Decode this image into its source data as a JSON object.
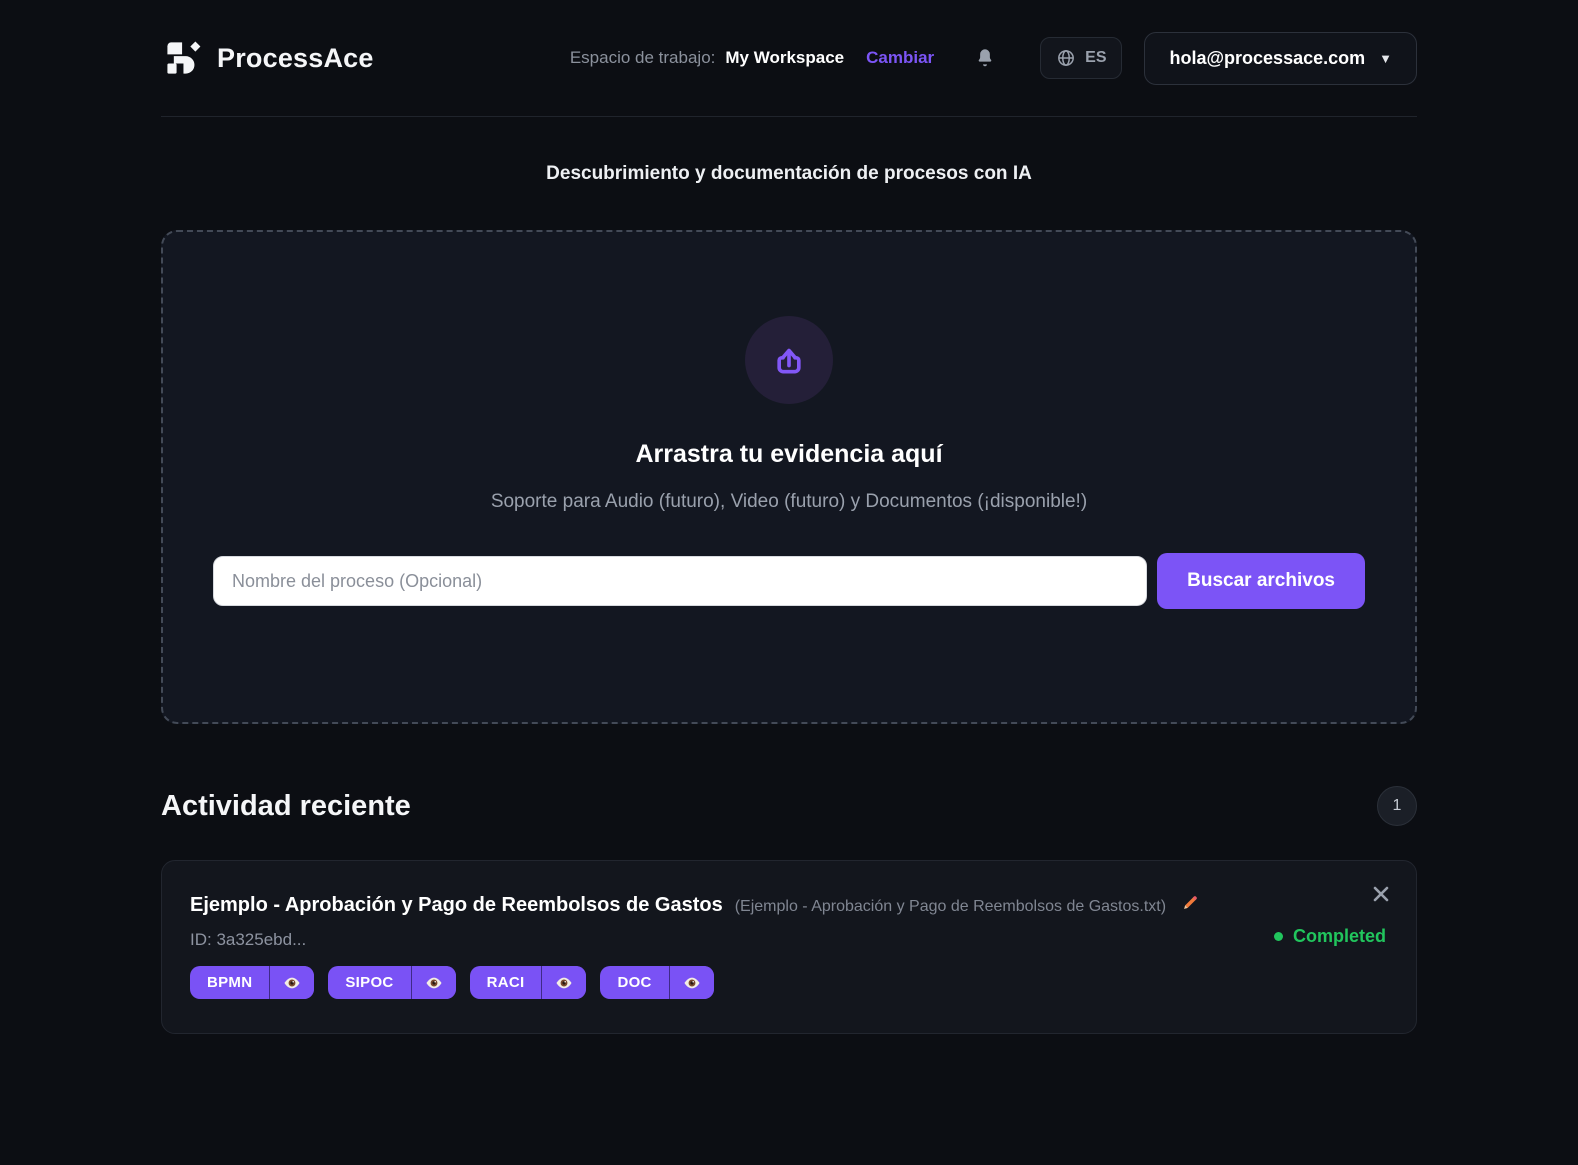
{
  "header": {
    "brand": "ProcessAce",
    "workspace_label": "Espacio de trabajo:",
    "workspace_name": "My Workspace",
    "change_link": "Cambiar",
    "language": "ES",
    "account_email": "hola@processace.com",
    "account_caret": "▼"
  },
  "icons": {
    "logo": "processace-logo-mark",
    "bell": "notification-bell",
    "globe": "language-globe",
    "upload": "upload-arrow-tray",
    "pencil": "edit-pencil",
    "eye": "view-eye",
    "close": "close-x"
  },
  "main": {
    "page_subtitle": "Descubrimiento y documentación de procesos con IA",
    "dropzone": {
      "title": "Arrastra tu evidencia aquí",
      "subtitle": "Soporte para Audio (futuro), Video (futuro) y Documentos (¡disponible!)",
      "input_placeholder": "Nombre del proceso (Opcional)",
      "browse_button": "Buscar archivos"
    }
  },
  "activity": {
    "heading": "Actividad reciente",
    "count_badge": "1",
    "items": [
      {
        "title": "Ejemplo - Aprobación y Pago de Reembolsos de Gastos",
        "filename": "(Ejemplo - Aprobación y Pago de Reembolsos de Gastos.txt)",
        "id_text": "ID: 3a325ebd...",
        "status": "Completed",
        "badges": [
          "BPMN",
          "SIPOC",
          "RACI",
          "DOC"
        ]
      }
    ]
  },
  "colors": {
    "accent": "#7c54f6",
    "success": "#21c55d",
    "page_bg": "#0c0e13",
    "panel_bg": "#131721",
    "card_bg": "#13161d"
  }
}
